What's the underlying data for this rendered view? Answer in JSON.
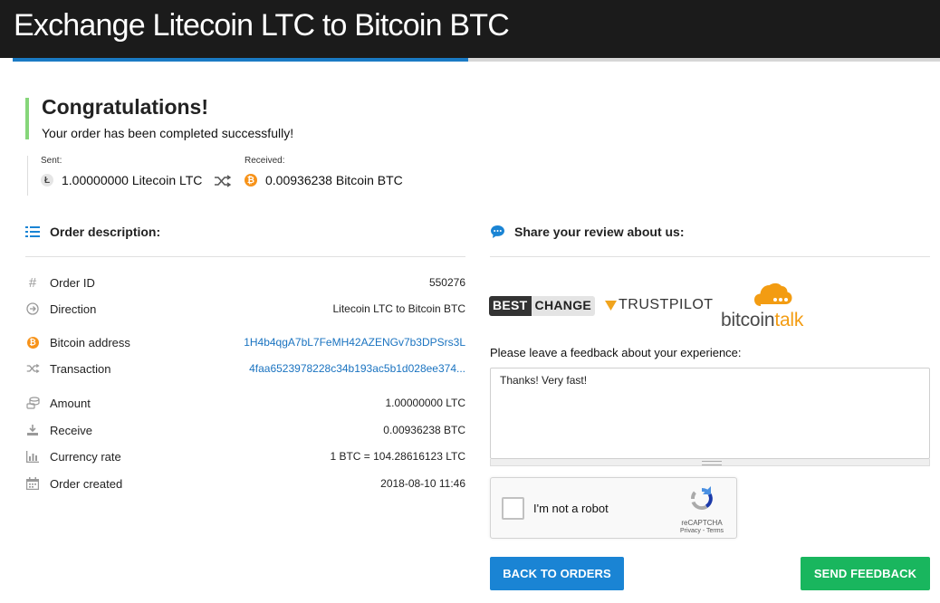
{
  "header": {
    "title": "Exchange Litecoin LTC to Bitcoin BTC",
    "progress_percent": 49.1
  },
  "status": {
    "title": "Congratulations!",
    "message": "Your order has been completed successfully!"
  },
  "exchange": {
    "sent_label": "Sent:",
    "sent_amount": "1.00000000 Litecoin LTC",
    "received_label": "Received:",
    "received_amount": "0.00936238 Bitcoin BTC"
  },
  "order": {
    "heading": "Order description:",
    "rows": [
      {
        "icon": "hash-icon",
        "key": "Order ID",
        "value": "550276"
      },
      {
        "icon": "arrow-circle-right-icon",
        "key": "Direction",
        "value": "Litecoin LTC to Bitcoin BTC"
      },
      {
        "icon": "bitcoin-icon",
        "key": "Bitcoin address",
        "value": "1H4b4qgA7bL7FeMH42AZENGv7b3DPSrs3L"
      },
      {
        "icon": "shuffle-icon",
        "key": "Transaction",
        "value": "4faa6523978228c34b193ac5b1d028ee374..."
      },
      {
        "icon": "coins-icon",
        "key": "Amount",
        "value": "1.00000000 LTC"
      },
      {
        "icon": "download-icon",
        "key": "Receive",
        "value": "0.00936238 BTC"
      },
      {
        "icon": "bar-chart-icon",
        "key": "Currency rate",
        "value": "1 BTC = 104.28616123 LTC"
      },
      {
        "icon": "calendar-icon",
        "key": "Order created",
        "value": "2018-08-10 11:46"
      }
    ]
  },
  "review": {
    "heading": "Share your review about us:",
    "bestchange_a": "BEST",
    "bestchange_b": "CHANGE",
    "trustpilot": "TRUSTPILOT",
    "bitcointalk_a": "bitcoin",
    "bitcointalk_b": "talk",
    "feedback_label": "Please leave a feedback about your experience:",
    "feedback_text": "Thanks! Very fast!"
  },
  "captcha": {
    "label": "I'm not a robot",
    "brand": "reCAPTCHA",
    "terms": "Privacy - Terms"
  },
  "buttons": {
    "back": "BACK TO ORDERS",
    "send": "SEND FEEDBACK"
  },
  "colors": {
    "accent_blue": "#1a84d4",
    "success_green": "#19b65e",
    "link": "#1a73c0",
    "bitcoin_orange": "#f7931a"
  }
}
